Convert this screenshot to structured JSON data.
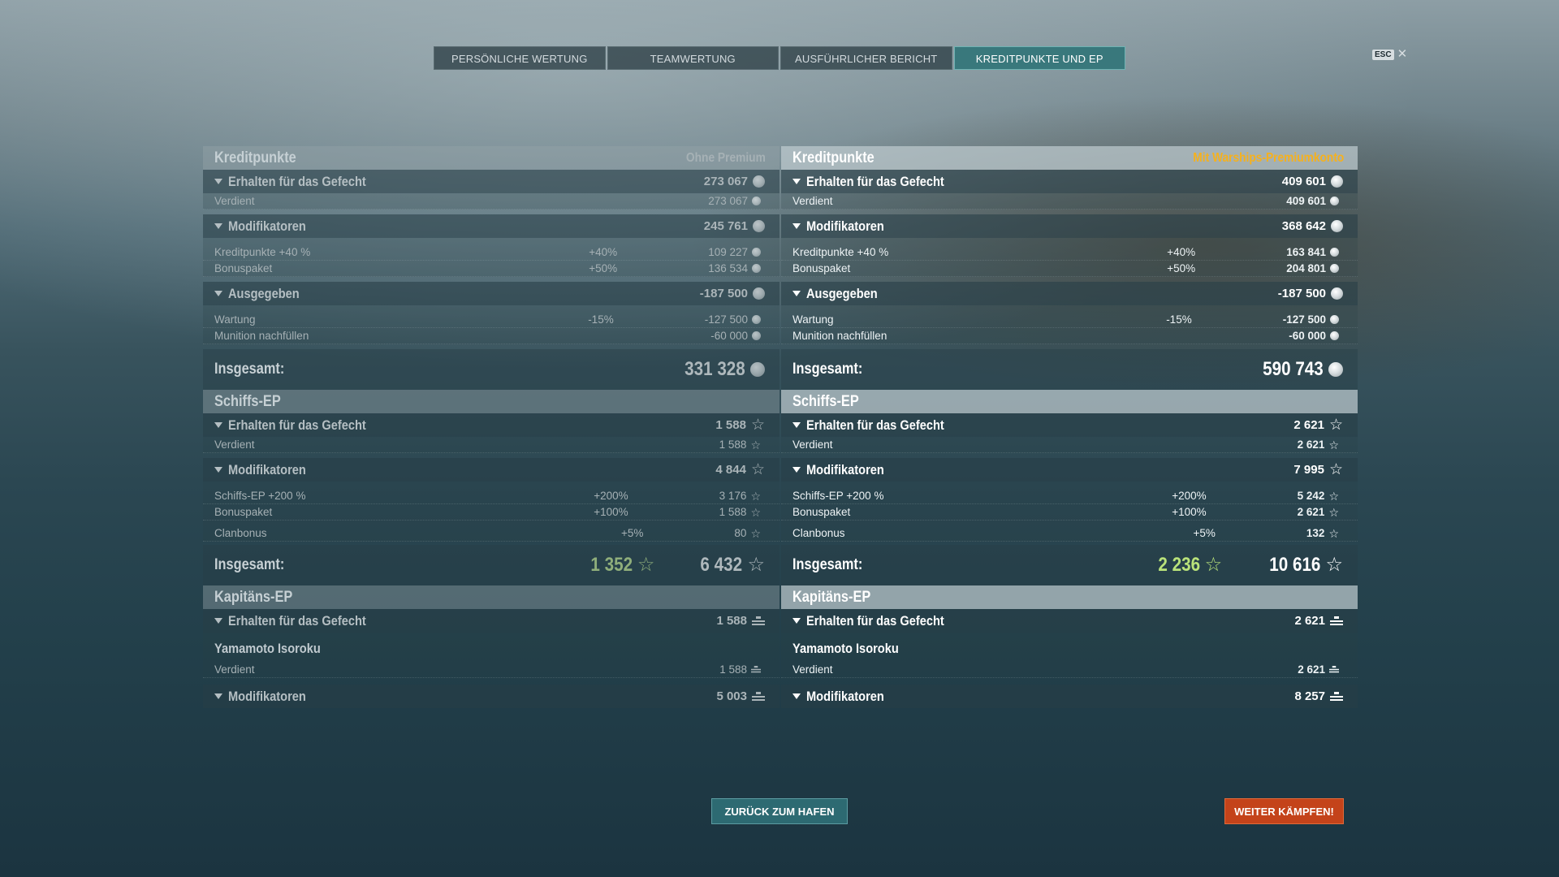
{
  "tabs": [
    {
      "label": "PERSÖNLICHE WERTUNG",
      "active": false
    },
    {
      "label": "TEAMWERTUNG",
      "active": false
    },
    {
      "label": "AUSFÜHRLICHER BERICHT",
      "active": false
    },
    {
      "label": "KREDITPUNKTE UND EP",
      "active": true
    }
  ],
  "esc_label": "ESC",
  "left": {
    "credits": {
      "title": "Kreditpunkte",
      "subtitle": "Ohne Premium",
      "earned": {
        "label": "Erhalten für das Gefecht",
        "value": "273 067"
      },
      "earned_rows": [
        {
          "name": "Verdient",
          "pct": "",
          "value": "273 067"
        }
      ],
      "modifiers": {
        "label": "Modifikatoren",
        "value": "245 761"
      },
      "modifier_rows": [
        {
          "name": "Kreditpunkte +40 %",
          "pct": "+40%",
          "value": "109 227"
        },
        {
          "name": "Bonuspaket",
          "pct": "+50%",
          "value": "136 534"
        }
      ],
      "spent": {
        "label": "Ausgegeben",
        "value": "-187 500"
      },
      "spent_rows": [
        {
          "name": "Wartung",
          "pct": "-15%",
          "value": "-127 500"
        },
        {
          "name": "Munition nachfüllen",
          "pct": "",
          "value": "-60 000"
        }
      ],
      "total": {
        "label": "Insgesamt:",
        "value": "331 328"
      }
    },
    "ship_xp": {
      "title": "Schiffs-EP",
      "earned": {
        "label": "Erhalten für das Gefecht",
        "value": "1 588"
      },
      "earned_rows": [
        {
          "name": "Verdient",
          "pct": "",
          "value": "1 588"
        }
      ],
      "modifiers": {
        "label": "Modifikatoren",
        "value": "4 844"
      },
      "modifier_rows": [
        {
          "name": "Schiffs-EP +200 %",
          "pct": "+200%",
          "value": "3 176"
        },
        {
          "name": "Bonuspaket",
          "pct": "+100%",
          "value": "1 588"
        }
      ],
      "clan_row": {
        "name": "Clanbonus",
        "pct": "+5%",
        "value": "80"
      },
      "total": {
        "label": "Insgesamt:",
        "free_value": "1 352",
        "value": "6 432"
      }
    },
    "captain_xp": {
      "title": "Kapitäns-EP",
      "earned": {
        "label": "Erhalten für das Gefecht",
        "value": "1 588"
      },
      "captain_name": "Yamamoto Isoroku",
      "earned_rows": [
        {
          "name": "Verdient",
          "pct": "",
          "value": "1 588"
        }
      ],
      "modifiers": {
        "label": "Modifikatoren",
        "value": "5 003"
      }
    }
  },
  "right": {
    "credits": {
      "title": "Kreditpunkte",
      "subtitle": "Mit Warships-Premiumkonto",
      "earned": {
        "label": "Erhalten für das Gefecht",
        "value": "409 601"
      },
      "earned_rows": [
        {
          "name": "Verdient",
          "pct": "",
          "value": "409 601"
        }
      ],
      "modifiers": {
        "label": "Modifikatoren",
        "value": "368 642"
      },
      "modifier_rows": [
        {
          "name": "Kreditpunkte +40 %",
          "pct": "+40%",
          "value": "163 841"
        },
        {
          "name": "Bonuspaket",
          "pct": "+50%",
          "value": "204 801"
        }
      ],
      "spent": {
        "label": "Ausgegeben",
        "value": "-187 500"
      },
      "spent_rows": [
        {
          "name": "Wartung",
          "pct": "-15%",
          "value": "-127 500"
        },
        {
          "name": "Munition nachfüllen",
          "pct": "",
          "value": "-60 000"
        }
      ],
      "total": {
        "label": "Insgesamt:",
        "value": "590 743"
      }
    },
    "ship_xp": {
      "title": "Schiffs-EP",
      "earned": {
        "label": "Erhalten für das Gefecht",
        "value": "2 621"
      },
      "earned_rows": [
        {
          "name": "Verdient",
          "pct": "",
          "value": "2 621"
        }
      ],
      "modifiers": {
        "label": "Modifikatoren",
        "value": "7 995"
      },
      "modifier_rows": [
        {
          "name": "Schiffs-EP +200 %",
          "pct": "+200%",
          "value": "5 242"
        },
        {
          "name": "Bonuspaket",
          "pct": "+100%",
          "value": "2 621"
        }
      ],
      "clan_row": {
        "name": "Clanbonus",
        "pct": "+5%",
        "value": "132"
      },
      "total": {
        "label": "Insgesamt:",
        "free_value": "2 236",
        "value": "10 616"
      }
    },
    "captain_xp": {
      "title": "Kapitäns-EP",
      "earned": {
        "label": "Erhalten für das Gefecht",
        "value": "2 621"
      },
      "captain_name": "Yamamoto Isoroku",
      "earned_rows": [
        {
          "name": "Verdient",
          "pct": "",
          "value": "2 621"
        }
      ],
      "modifiers": {
        "label": "Modifikatoren",
        "value": "8 257"
      }
    }
  },
  "buttons": {
    "harbor": "ZURÜCK ZUM HAFEN",
    "fight": "WEITER KÄMPFEN!"
  },
  "icons": {
    "credits": "credits-coin-icon",
    "xp": "xp-star-icon",
    "captain_xp": "captain-xp-icon",
    "expand": "triangle-down-icon",
    "close": "close-x-icon"
  },
  "colors": {
    "active_tab": "#39787c",
    "premium_accent": "#f6b11c",
    "free_xp_green": "#b9e27a",
    "fight_button": "#c4431a",
    "harbor_button": "#2d6a72"
  }
}
